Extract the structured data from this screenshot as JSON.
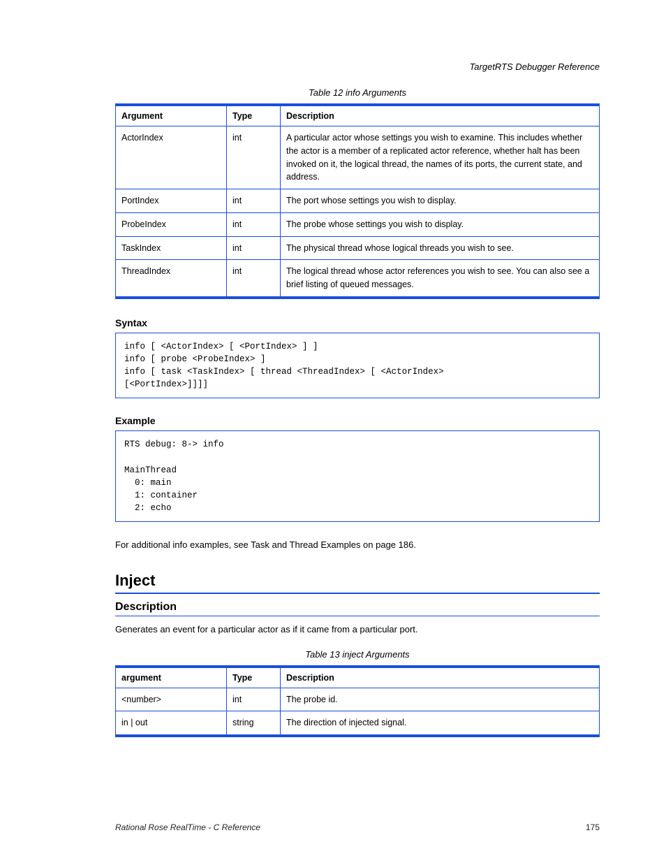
{
  "header": {
    "section_label": "TargetRTS Debugger Reference"
  },
  "table1": {
    "caption": "Table 12 info Arguments",
    "headers": {
      "argument": "Argument",
      "type": "Type",
      "description": "Description"
    },
    "rows": [
      {
        "argument": "ActorIndex",
        "type": "int",
        "description": "A particular actor whose settings you wish to examine. This includes whether the actor is a member of a replicated actor reference, whether halt has been invoked on it, the logical thread, the names of its ports, the current state, and address."
      },
      {
        "argument": "PortIndex",
        "type": "int",
        "description": "The port whose settings you wish to display."
      },
      {
        "argument": "ProbeIndex",
        "type": "int",
        "description": "The probe whose settings you wish to display."
      },
      {
        "argument": "TaskIndex",
        "type": "int",
        "description": "The physical thread whose logical threads you wish to see."
      },
      {
        "argument": "ThreadIndex",
        "type": "int",
        "description": "The logical thread whose actor references you wish to see. You can also see a brief listing of queued messages."
      }
    ]
  },
  "syntax": {
    "heading": "Syntax",
    "code": "info [ <ActorIndex> [ <PortIndex> ] ]\ninfo [ probe <ProbeIndex> ]\ninfo [ task <TaskIndex> [ thread <ThreadIndex> [ <ActorIndex>\n[<PortIndex>]]]]"
  },
  "example": {
    "heading": "Example",
    "code": "RTS debug: 8-> info\n\nMainThread\n  0: main\n  1: container\n  2: echo",
    "note": "For additional info examples, see Task and Thread  Examples on page 186."
  },
  "h_level": "Inject",
  "h_sub": "Description",
  "inject_desc": "Generates an event for a particular actor as if it came from a particular port.",
  "table2": {
    "caption": "Table 13 inject Arguments",
    "headers": {
      "argument": "argument",
      "type": "Type",
      "description": "Description"
    },
    "rows": [
      {
        "argument": "<number>",
        "type": "int",
        "description": "The probe id."
      },
      {
        "argument": "in | out",
        "type": "string",
        "description": "The direction of injected signal."
      }
    ]
  },
  "footer": {
    "left": "Rational Rose RealTime - C Reference",
    "right": "175"
  }
}
